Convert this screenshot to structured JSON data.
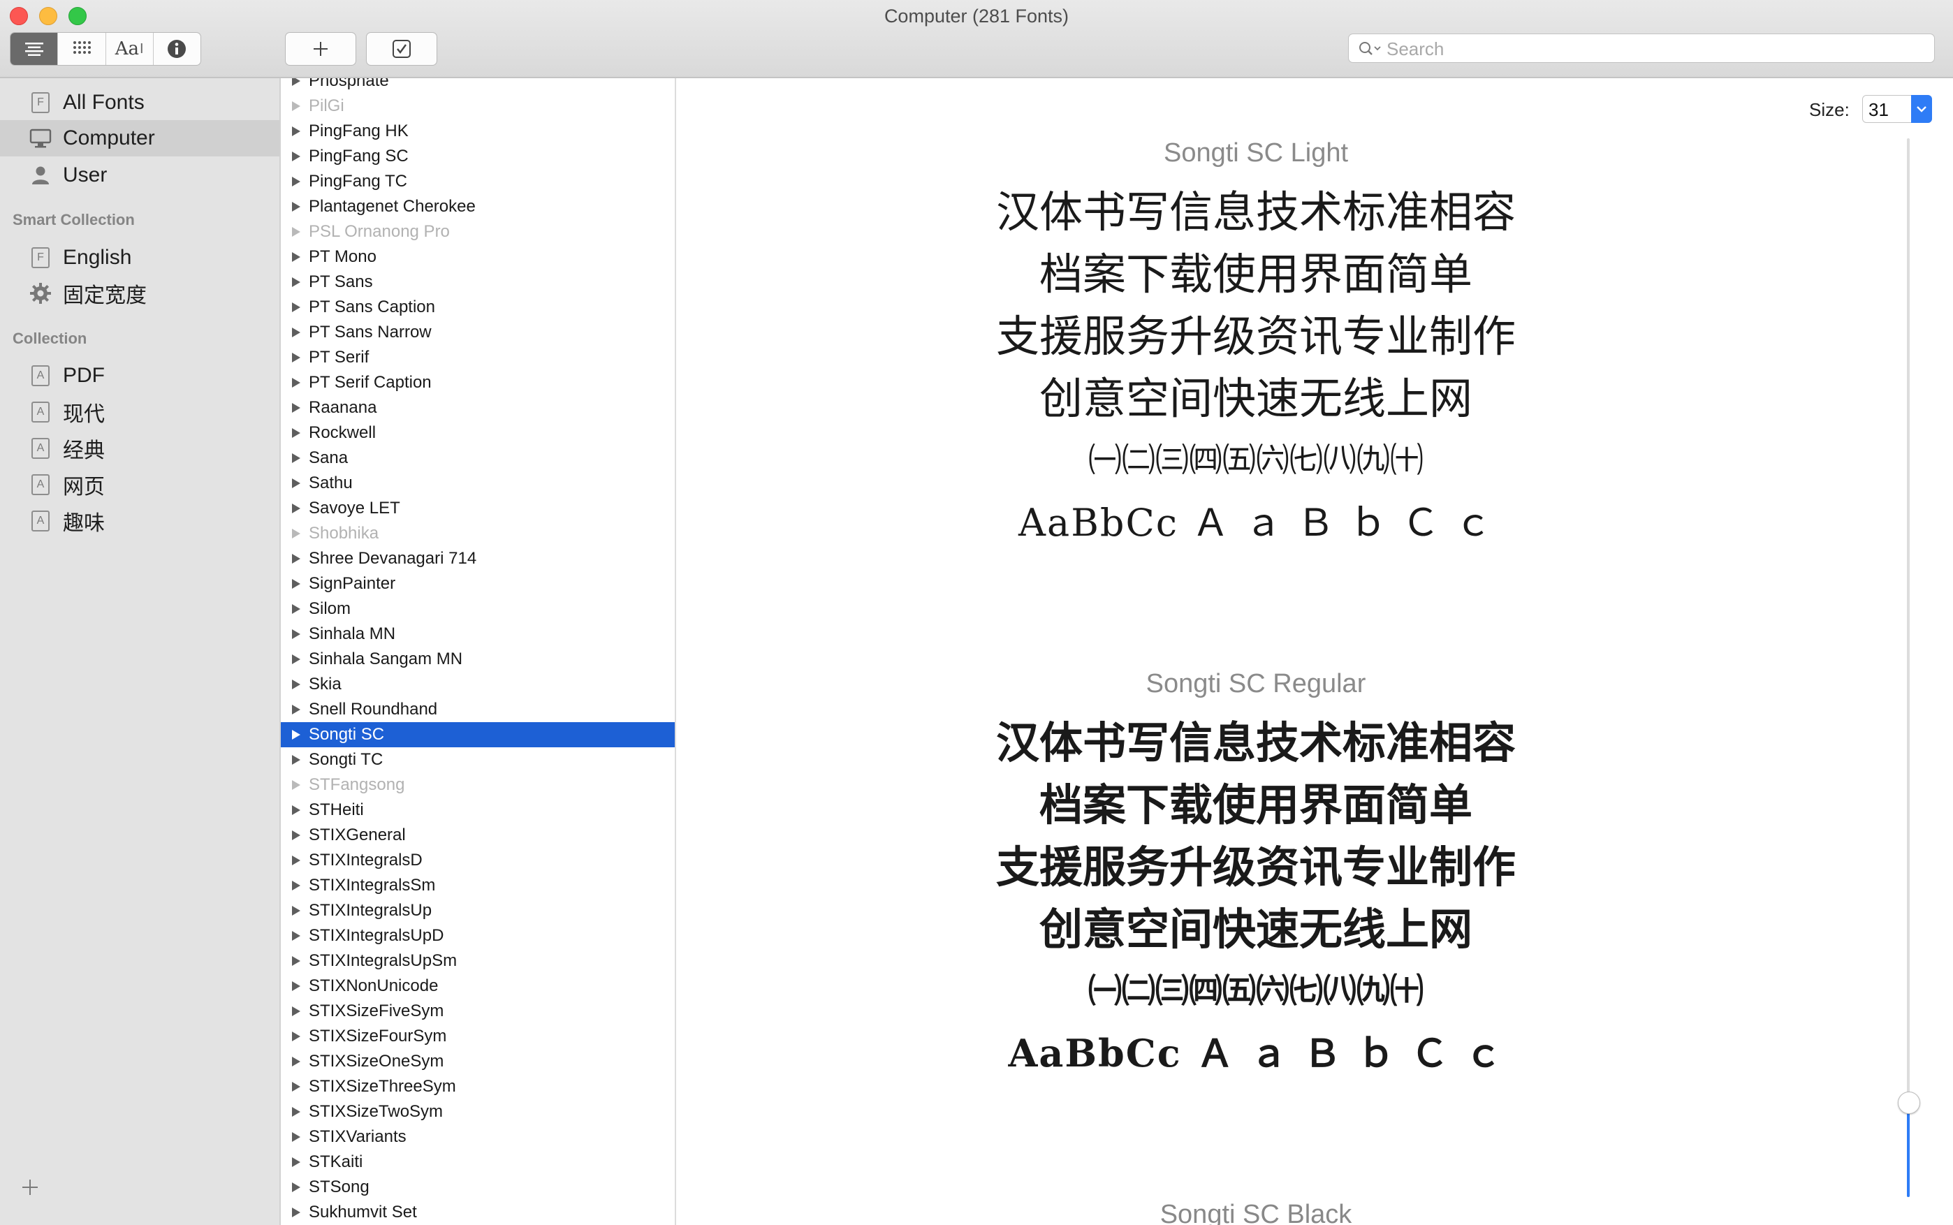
{
  "window": {
    "title": "Computer (281 Fonts)"
  },
  "toolbar": {
    "view_buttons": [
      "sample-list-view-icon",
      "grid-view-icon",
      "Aa",
      "info-icon"
    ],
    "add_button_icon": "plus-icon",
    "validate_button_icon": "checkbox-icon",
    "search_placeholder": "Search"
  },
  "sidebar": {
    "library_items": [
      {
        "label": "All Fonts",
        "icon": "font-file-icon"
      },
      {
        "label": "Computer",
        "icon": "monitor-icon",
        "selected": true
      },
      {
        "label": "User",
        "icon": "user-icon"
      }
    ],
    "smart_collection_header": "Smart Collection",
    "smart_collection_items": [
      {
        "label": "English",
        "icon": "font-file-icon"
      },
      {
        "label": "固定宽度",
        "icon": "gear-icon"
      }
    ],
    "collection_header": "Collection",
    "collection_items": [
      {
        "label": "PDF",
        "icon": "collection-icon"
      },
      {
        "label": "现代",
        "icon": "collection-icon"
      },
      {
        "label": "经典",
        "icon": "collection-icon"
      },
      {
        "label": "网页",
        "icon": "collection-icon"
      },
      {
        "label": "趣味",
        "icon": "collection-icon"
      }
    ],
    "add_collection_icon": "plus-icon"
  },
  "font_list": [
    {
      "name": "Phosphate"
    },
    {
      "name": "PilGi",
      "dim": true
    },
    {
      "name": "PingFang HK"
    },
    {
      "name": "PingFang SC"
    },
    {
      "name": "PingFang TC"
    },
    {
      "name": "Plantagenet Cherokee"
    },
    {
      "name": "PSL Ornanong Pro",
      "dim": true
    },
    {
      "name": "PT Mono"
    },
    {
      "name": "PT Sans"
    },
    {
      "name": "PT Sans Caption"
    },
    {
      "name": "PT Sans Narrow"
    },
    {
      "name": "PT Serif"
    },
    {
      "name": "PT Serif Caption"
    },
    {
      "name": "Raanana"
    },
    {
      "name": "Rockwell"
    },
    {
      "name": "Sana"
    },
    {
      "name": "Sathu"
    },
    {
      "name": "Savoye LET"
    },
    {
      "name": "Shobhika",
      "dim": true
    },
    {
      "name": "Shree Devanagari 714"
    },
    {
      "name": "SignPainter"
    },
    {
      "name": "Silom"
    },
    {
      "name": "Sinhala MN"
    },
    {
      "name": "Sinhala Sangam MN"
    },
    {
      "name": "Skia"
    },
    {
      "name": "Snell Roundhand"
    },
    {
      "name": "Songti SC",
      "selected": true
    },
    {
      "name": "Songti TC"
    },
    {
      "name": "STFangsong",
      "dim": true
    },
    {
      "name": "STHeiti"
    },
    {
      "name": "STIXGeneral"
    },
    {
      "name": "STIXIntegralsD"
    },
    {
      "name": "STIXIntegralsSm"
    },
    {
      "name": "STIXIntegralsUp"
    },
    {
      "name": "STIXIntegralsUpD"
    },
    {
      "name": "STIXIntegralsUpSm"
    },
    {
      "name": "STIXNonUnicode"
    },
    {
      "name": "STIXSizeFiveSym"
    },
    {
      "name": "STIXSizeFourSym"
    },
    {
      "name": "STIXSizeOneSym"
    },
    {
      "name": "STIXSizeThreeSym"
    },
    {
      "name": "STIXSizeTwoSym"
    },
    {
      "name": "STIXVariants"
    },
    {
      "name": "STKaiti"
    },
    {
      "name": "STSong"
    },
    {
      "name": "Sukhumvit Set"
    }
  ],
  "preview": {
    "size_label": "Size:",
    "size_value": "31",
    "samples": [
      {
        "title": "Songti SC Light",
        "lines": [
          "汉体书写信息技术标准相容",
          "档案下载使用界面简单",
          "支援服务升级资讯专业制作",
          "创意空间快速无线上网",
          "㈠㈡㈢㈣㈤㈥㈦㈧㈨㈩",
          "AaBbCc Ａ ａ Ｂ ｂ Ｃ ｃ"
        ]
      },
      {
        "title": "Songti SC Regular",
        "lines": [
          "汉体书写信息技术标准相容",
          "档案下载使用界面简单",
          "支援服务升级资讯专业制作",
          "创意空间快速无线上网",
          "㈠㈡㈢㈣㈤㈥㈦㈧㈨㈩",
          "AaBbCc Ａ ａ Ｂ ｂ Ｃ ｃ"
        ]
      },
      {
        "title": "Songti SC Black",
        "lines": []
      }
    ],
    "slider_level": 0.09
  }
}
